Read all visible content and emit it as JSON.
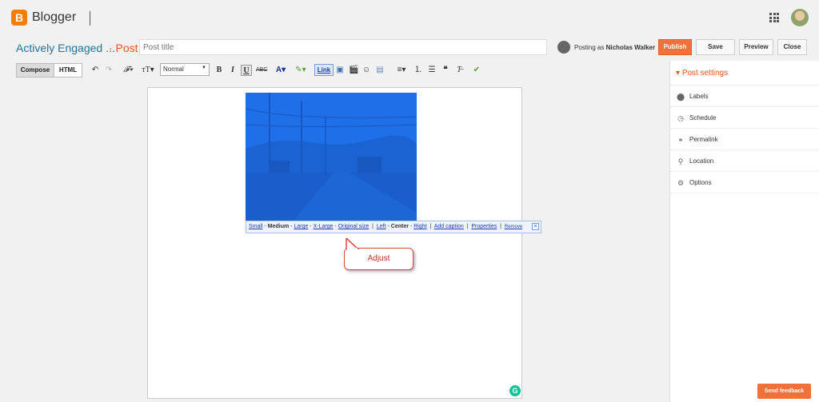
{
  "app": {
    "name": "Blogger"
  },
  "header": {
    "blog_name": "Actively Engaged ...",
    "post_label": "· Post",
    "title_placeholder": "Post title",
    "posting_as_prefix": "Posting as",
    "author": "Nicholas Walker",
    "publish": "Publish",
    "save": "Save",
    "preview": "Preview",
    "close": "Close"
  },
  "toolbar": {
    "compose": "Compose",
    "html": "HTML",
    "font_size": "Normal",
    "link": "Link"
  },
  "image_toolbar": {
    "small": "Small",
    "medium": "Medium",
    "large": "Large",
    "xlarge": "X-Large",
    "original": "Original size",
    "left": "Left",
    "center": "Center",
    "right": "Right",
    "add_caption": "Add caption",
    "properties": "Properties",
    "remove": "Remove"
  },
  "callout": {
    "text": "Adjust"
  },
  "sidebar": {
    "title": "Post settings",
    "items": [
      {
        "label": "Labels",
        "icon": "tag-icon"
      },
      {
        "label": "Schedule",
        "icon": "clock-icon"
      },
      {
        "label": "Permalink",
        "icon": "link-icon"
      },
      {
        "label": "Location",
        "icon": "location-pin-icon"
      },
      {
        "label": "Options",
        "icon": "gear-icon"
      }
    ]
  },
  "feedback": {
    "label": "Send feedback"
  },
  "colors": {
    "accent": "#f4511e",
    "publish": "#f2703a",
    "blog_link": "#21759b",
    "selection": "#1f6fe8"
  }
}
